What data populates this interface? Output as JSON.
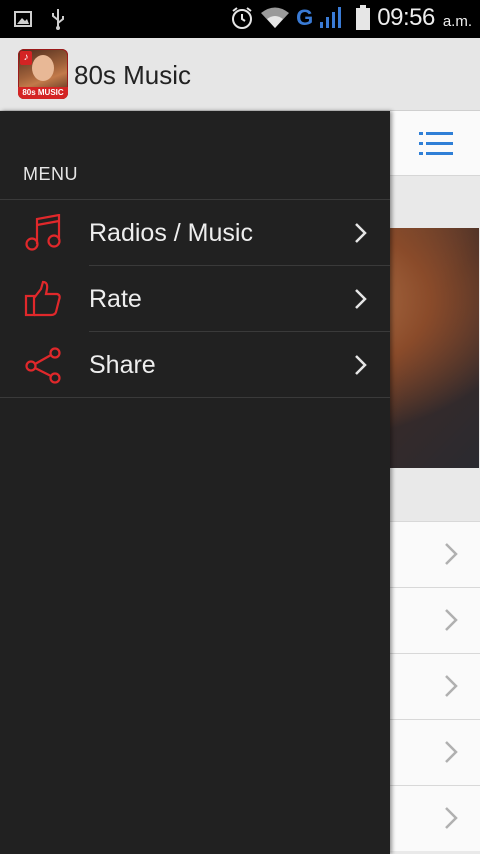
{
  "status_bar": {
    "network_type": "G",
    "time": "09:56",
    "ampm": "a.m.",
    "icons": [
      "image-icon",
      "usb-icon",
      "alarm-icon",
      "wifi-icon",
      "signal-icon",
      "battery-icon"
    ]
  },
  "app_bar": {
    "title": "80s Music",
    "app_icon_label": "80s MUSIC"
  },
  "drawer": {
    "header": "MENU",
    "items": [
      {
        "label": "Radios / Music",
        "icon": "music-note-icon"
      },
      {
        "label": "Rate",
        "icon": "thumbs-up-icon"
      },
      {
        "label": "Share",
        "icon": "share-icon"
      }
    ]
  },
  "background": {
    "toolbar_icon": "list-icon",
    "row_count": 5
  },
  "colors": {
    "accent_red": "#e0282b",
    "drawer_bg": "#212121",
    "list_icon_blue": "#2f7fd6",
    "status_g_blue": "#3a7bd5"
  }
}
